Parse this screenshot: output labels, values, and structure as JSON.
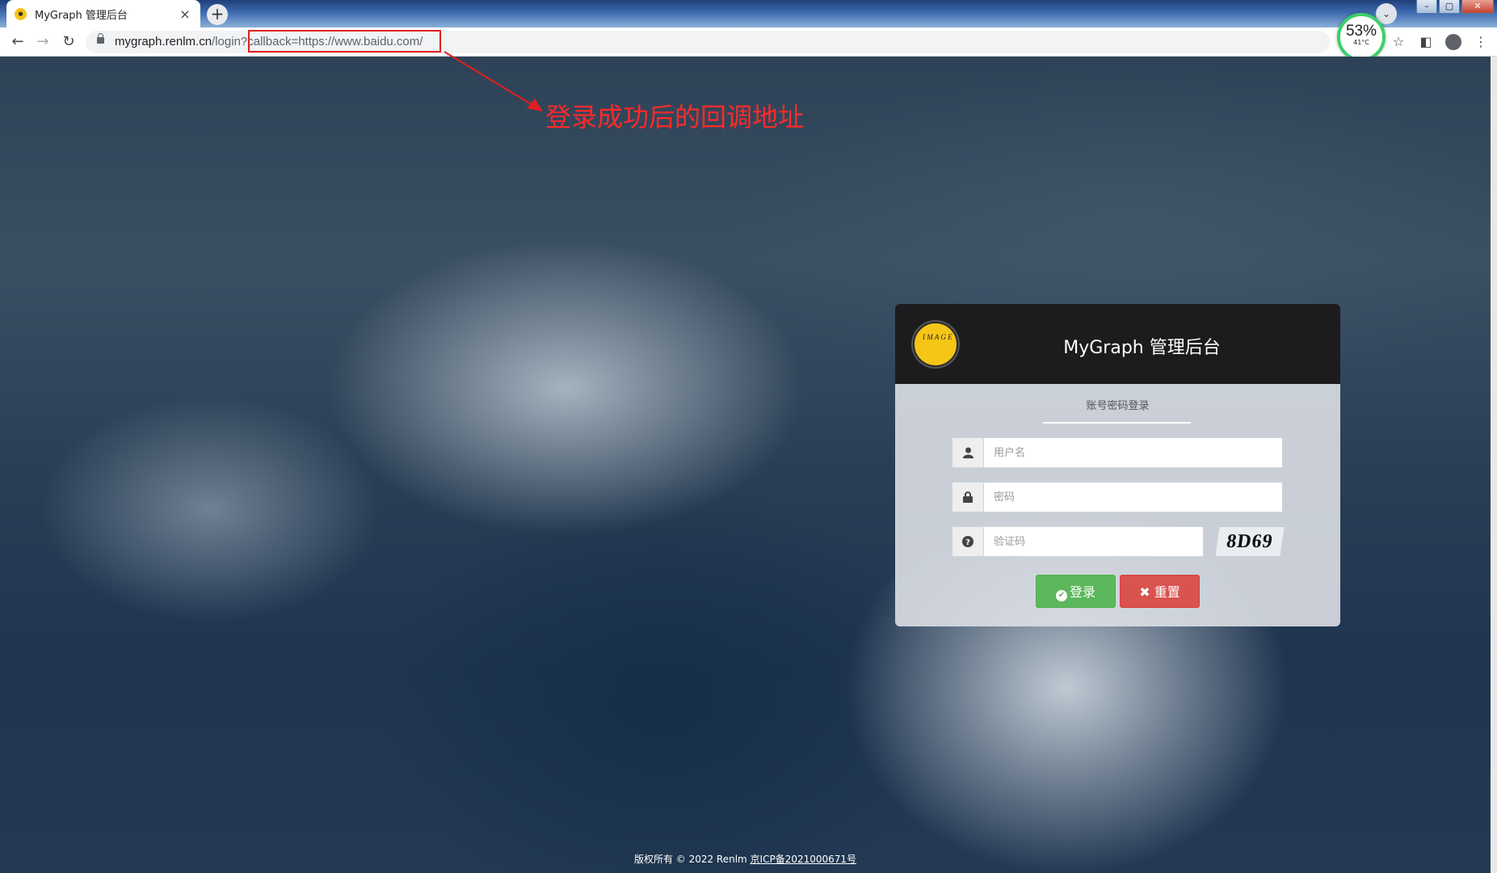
{
  "browser": {
    "tab_title": "MyGraph 管理后台",
    "tab_close": "×",
    "new_tab": "+",
    "url_host": "mygraph.renlm.cn",
    "url_path": "/login?callback=https://www.baidu.com/",
    "perf_percent": "53%",
    "perf_temp": "41°C",
    "window_buttons": [
      "–",
      "▢",
      "✕"
    ]
  },
  "annotation": {
    "text": "登录成功后的回调地址"
  },
  "login": {
    "title": "MyGraph 管理后台",
    "logo_text": "I M A G E",
    "tab_label": "账号密码登录",
    "username_placeholder": "用户名",
    "password_placeholder": "密码",
    "captcha_placeholder": "验证码",
    "captcha_text": "8D69",
    "login_button": "登录",
    "reset_button": "重置"
  },
  "footer": {
    "copyright": "版权所有 © 2022 Renlm ",
    "icp": "京ICP备2021000671号"
  },
  "colors": {
    "accent_red": "#e02020",
    "login_green": "#5cb85c",
    "reset_red": "#d9534f",
    "logo_yellow": "#f5c518"
  }
}
